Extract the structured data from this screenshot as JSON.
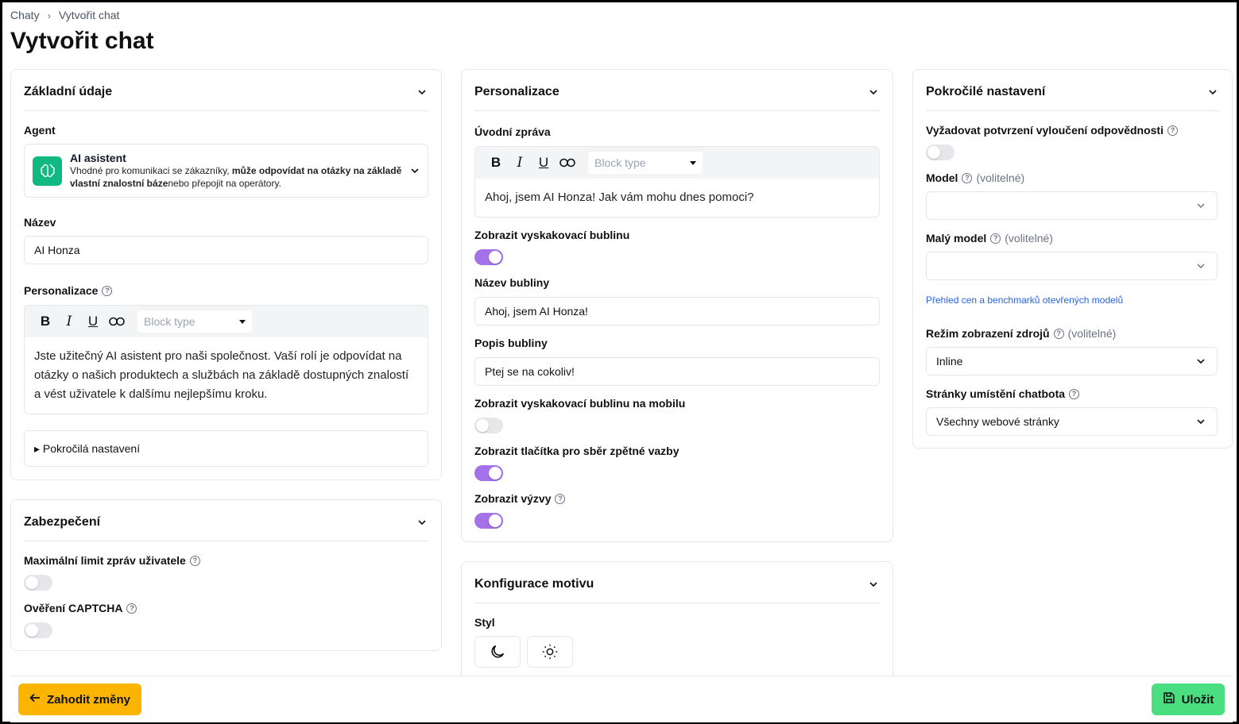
{
  "breadcrumb": {
    "root": "Chaty",
    "current": "Vytvořit chat"
  },
  "page": {
    "title": "Vytvořit chat"
  },
  "basic": {
    "title": "Základní údaje",
    "agent_label": "Agent",
    "agent_name": "AI asistent",
    "agent_desc_1": "Vhodné pro komunikaci se zákazníky, ",
    "agent_desc_bold": "může odpovídat na otázky na základě vlastní znalostní báze",
    "agent_desc_2": "nebo přepojit na operátory.",
    "name_label": "Název",
    "name_value": "AI Honza",
    "personalization_label": "Personalizace",
    "block_type": "Block type",
    "personalization_text": "Jste užitečný AI asistent pro naši společnost. Vaší rolí je odpovídat na otázky o našich produktech a službách na základě dostupných znalostí a vést uživatele k dalšímu nejlepšímu kroku.",
    "advanced_summary": "▸ Pokročilá nastavení"
  },
  "security": {
    "title": "Zabezpečení",
    "max_limit_label": "Maximální limit zpráv uživatele",
    "captcha_label": "Ověření CAPTCHA"
  },
  "personal": {
    "title": "Personalizace",
    "intro_label": "Úvodní zpráva",
    "block_type": "Block type",
    "intro_text": "Ahoj, jsem AI Honza! Jak vám mohu dnes pomoci?",
    "show_bubble_label": "Zobrazit vyskakovací bublinu",
    "bubble_name_label": "Název bubliny",
    "bubble_name_value": "Ahoj, jsem AI Honza!",
    "bubble_desc_label": "Popis bubliny",
    "bubble_desc_value": "Ptej se na cokoliv!",
    "show_mobile_label": "Zobrazit vyskakovací bublinu na mobilu",
    "feedback_label": "Zobrazit tlačítka pro sběr zpětné vazby",
    "prompts_label": "Zobrazit výzvy"
  },
  "theme": {
    "title": "Konfigurace motivu",
    "style_label": "Styl"
  },
  "advanced": {
    "title": "Pokročilé nastavení",
    "disclaimer_label": "Vyžadovat potvrzení vyloučení odpovědnosti",
    "model_label": "Model",
    "optional": "(volitelné)",
    "small_model_label": "Malý model",
    "pricing_link": "Přehled cen a benchmarků otevřených modelů",
    "source_mode_label": "Režim zobrazení zdrojů",
    "source_mode_value": "Inline",
    "placement_label": "Stránky umístění chatbota",
    "placement_value": "Všechny webové stránky"
  },
  "footer": {
    "discard": "Zahodit změny",
    "save": "Uložit"
  },
  "colors": {
    "accent_toggle": "#a471e8",
    "discard_button": "#fbb500",
    "save_button": "#4ade80",
    "agent_icon": "#10b981"
  }
}
